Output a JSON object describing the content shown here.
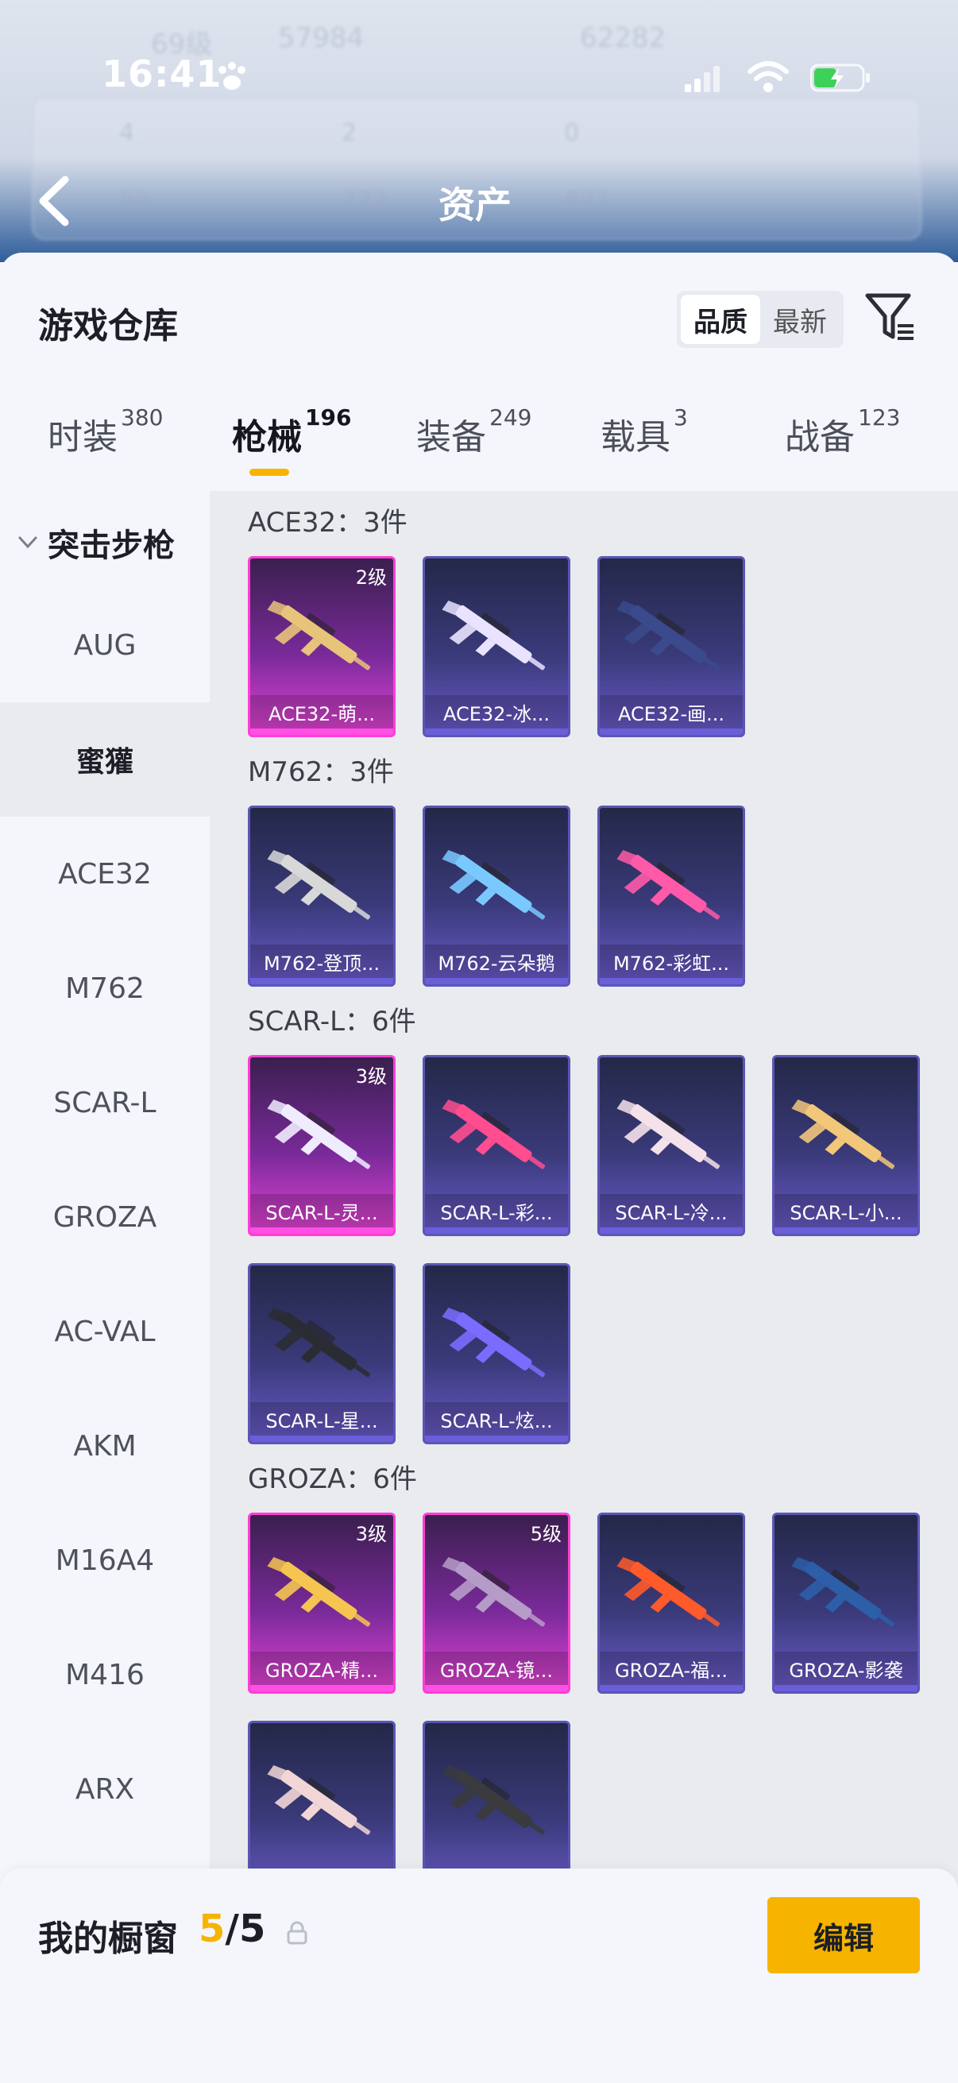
{
  "status_bar": {
    "time": "16:41"
  },
  "background": {
    "level_text": "69级",
    "stat_a": "57984",
    "stat_b": "62282",
    "row1": [
      "4",
      "2",
      "0"
    ],
    "row2": [
      "80",
      "232",
      "823"
    ],
    "title": "资产"
  },
  "sheet": {
    "title": "游戏仓库",
    "sort_options": [
      {
        "label": "品质",
        "active": true
      },
      {
        "label": "最新",
        "active": false
      }
    ]
  },
  "categories": [
    {
      "label": "时装",
      "count": "380"
    },
    {
      "label": "枪械",
      "count": "196",
      "active": true
    },
    {
      "label": "装备",
      "count": "249"
    },
    {
      "label": "载具",
      "count": "3"
    },
    {
      "label": "战备",
      "count": "123"
    }
  ],
  "sidebar": {
    "group": "突击步枪",
    "items": [
      "AUG",
      "蜜獾",
      "ACE32",
      "M762",
      "SCAR-L",
      "GROZA",
      "AC-VAL",
      "AKM",
      "M16A4",
      "M416",
      "ARX"
    ],
    "selected": "蜜獾"
  },
  "sections": [
    {
      "title": "ACE32：3件",
      "items": [
        {
          "name": "ACE32-萌...",
          "level": "2级",
          "tier": "gold",
          "color": "#e8c37a"
        },
        {
          "name": "ACE32-冰...",
          "level": "",
          "tier": "purple",
          "color": "#e9e3ff"
        },
        {
          "name": "ACE32-画...",
          "level": "",
          "tier": "purple",
          "color": "#3b4a8c"
        }
      ]
    },
    {
      "title": "M762：3件",
      "items": [
        {
          "name": "M762-登顶...",
          "level": "",
          "tier": "purple",
          "color": "#d8d8d8"
        },
        {
          "name": "M762-云朵鹅",
          "level": "",
          "tier": "purple",
          "color": "#79c9ff"
        },
        {
          "name": "M762-彩虹...",
          "level": "",
          "tier": "purple",
          "color": "#ff5aa9"
        }
      ]
    },
    {
      "title": "SCAR-L：6件",
      "items": [
        {
          "name": "SCAR-L-灵...",
          "level": "3级",
          "tier": "gold",
          "color": "#f0ecff"
        },
        {
          "name": "SCAR-L-彩...",
          "level": "",
          "tier": "purple",
          "color": "#ff4d8f"
        },
        {
          "name": "SCAR-L-冷...",
          "level": "",
          "tier": "purple",
          "color": "#f5e1ea"
        },
        {
          "name": "SCAR-L-小...",
          "level": "",
          "tier": "purple",
          "color": "#f2c77a"
        },
        {
          "name": "SCAR-L-星...",
          "level": "",
          "tier": "purple",
          "color": "#2a2c33"
        },
        {
          "name": "SCAR-L-炫...",
          "level": "",
          "tier": "purple",
          "color": "#7b6cff"
        }
      ]
    },
    {
      "title": "GROZA：6件",
      "items": [
        {
          "name": "GROZA-精...",
          "level": "3级",
          "tier": "gold",
          "color": "#f5c451"
        },
        {
          "name": "GROZA-镜...",
          "level": "5级",
          "tier": "gold",
          "color": "#b59cc8"
        },
        {
          "name": "GROZA-福...",
          "level": "",
          "tier": "purple",
          "color": "#ff5a2a"
        },
        {
          "name": "GROZA-影袭",
          "level": "",
          "tier": "purple",
          "color": "#2d5ea8"
        },
        {
          "name": "",
          "level": "",
          "tier": "purple",
          "color": "#f2d6d6"
        },
        {
          "name": "",
          "level": "",
          "tier": "purple",
          "color": "#3a3a3f"
        }
      ]
    }
  ],
  "showcase": {
    "label": "我的橱窗",
    "current": "5",
    "total": "/5",
    "edit_label": "编辑"
  },
  "colors": {
    "accent": "#f6b400",
    "gold_border": "#ff3ed6",
    "purple_border": "#5b56b5"
  }
}
